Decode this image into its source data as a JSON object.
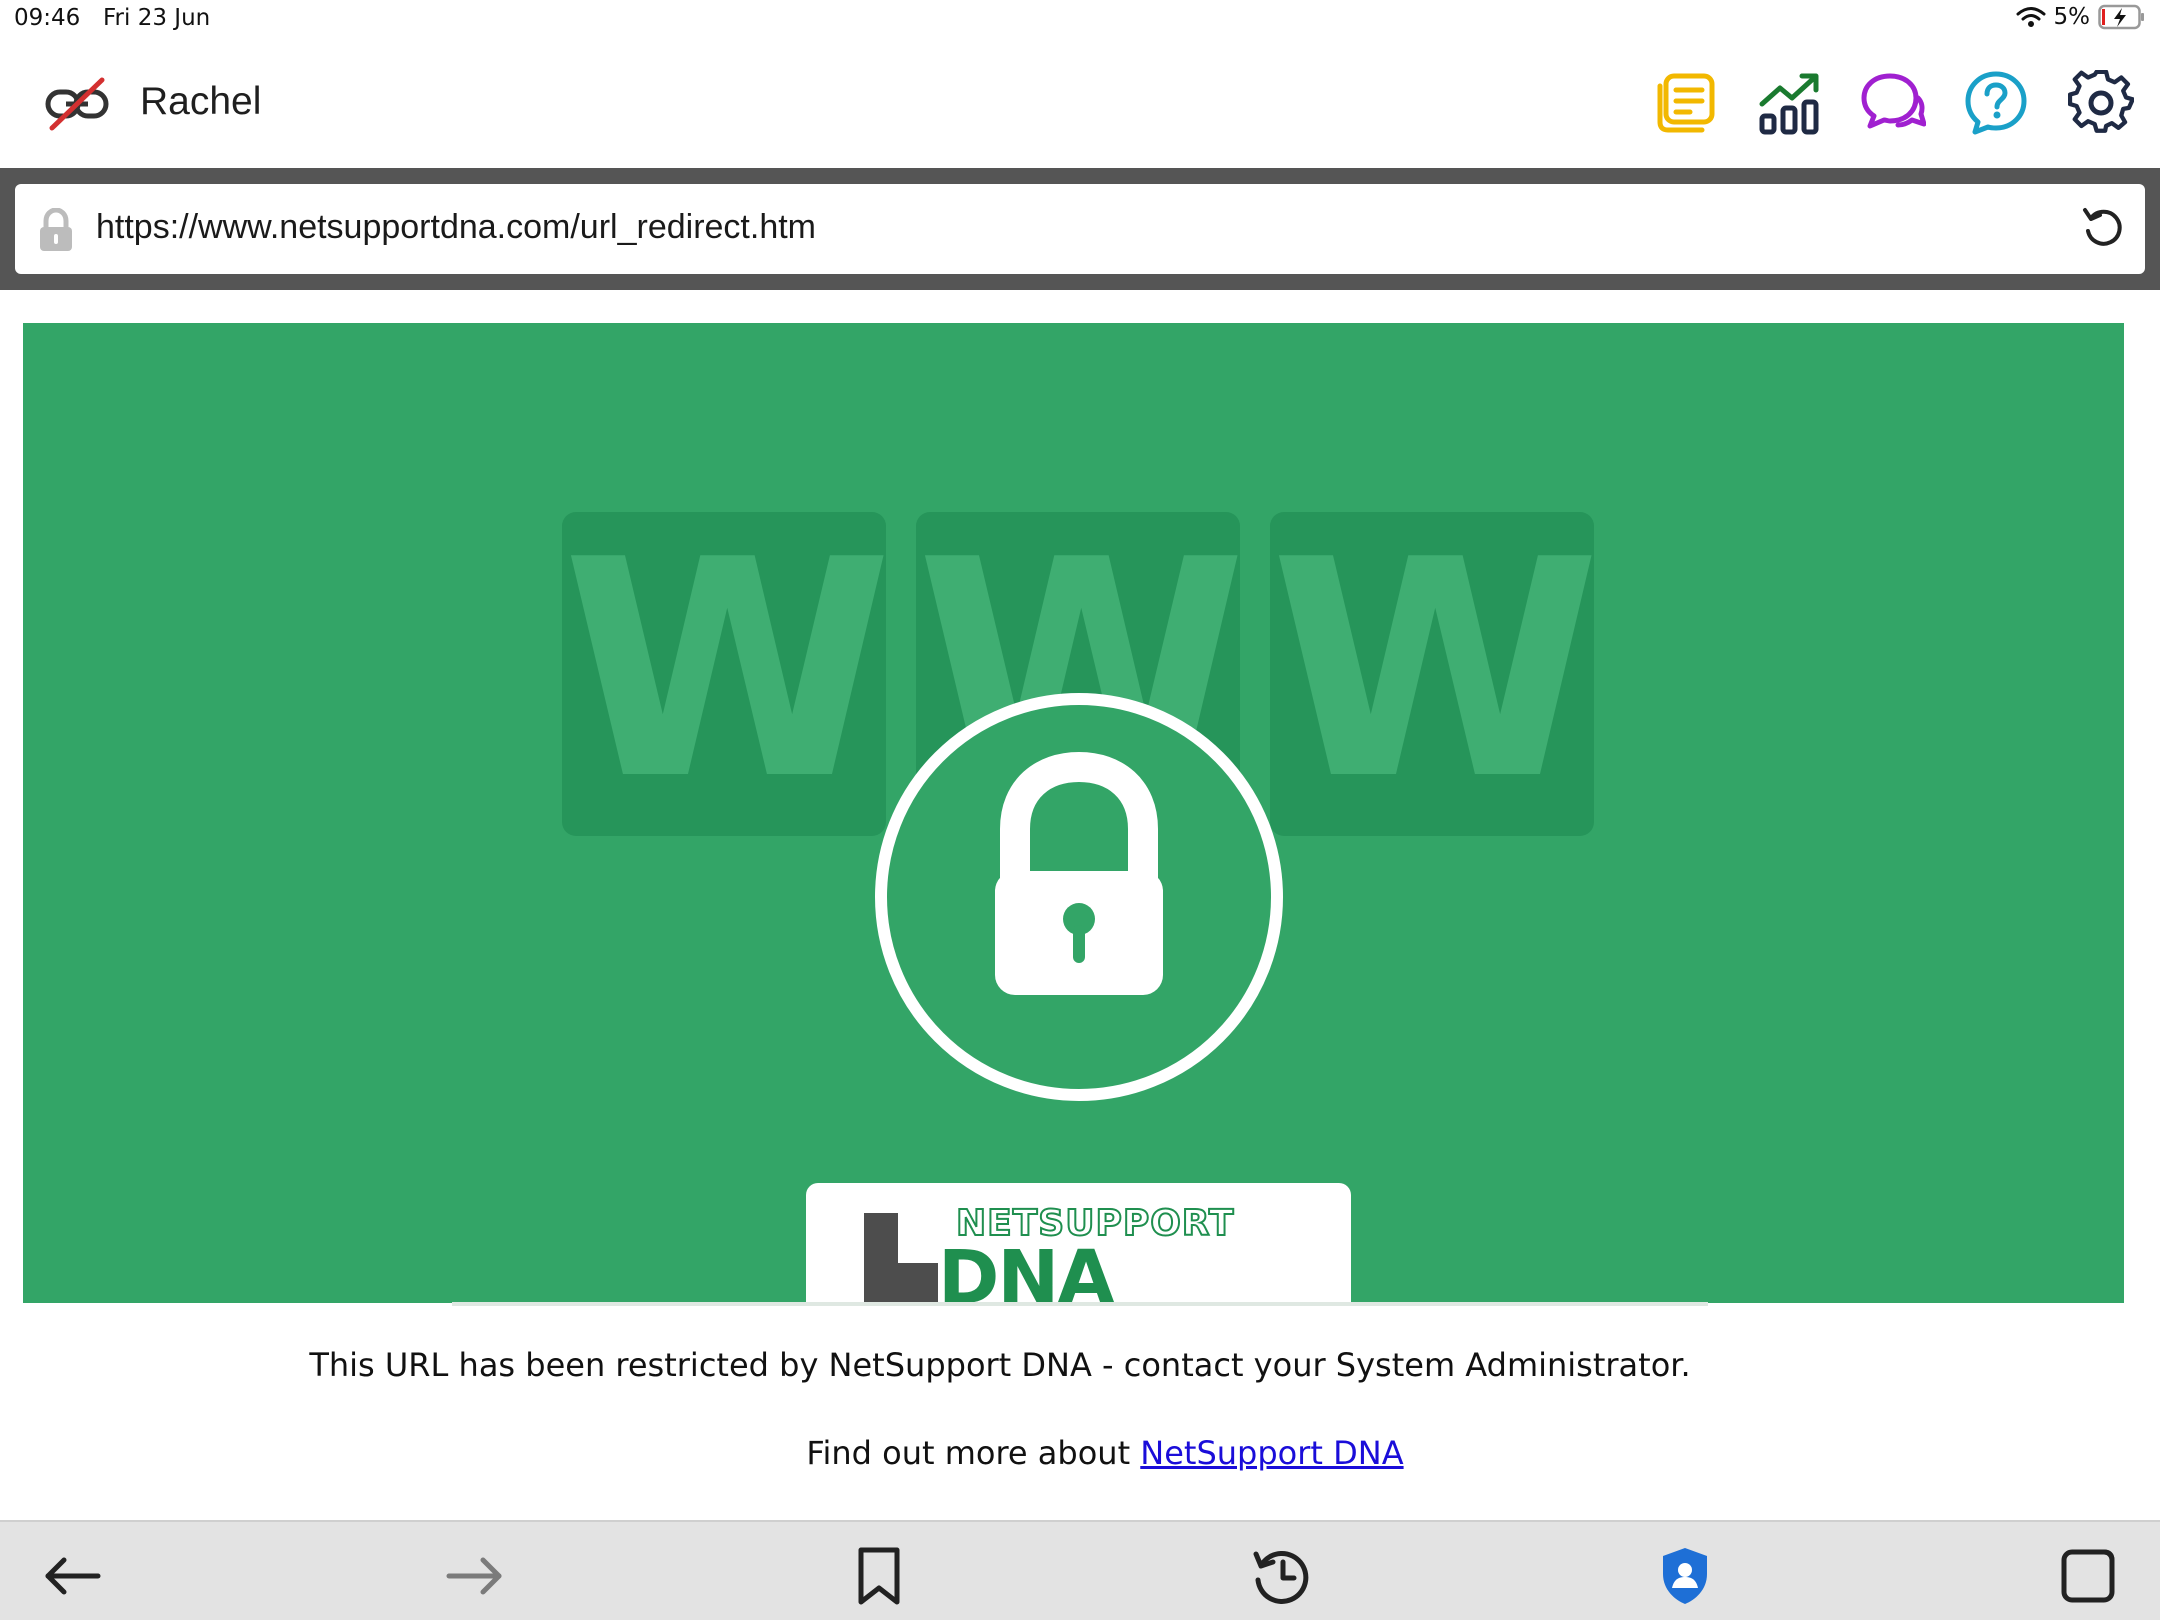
{
  "status_bar": {
    "time": "09:46",
    "date": "Fri 23 Jun",
    "battery": "5%",
    "icons": [
      "wifi-icon",
      "battery-charging-icon"
    ]
  },
  "header": {
    "user_name": "Rachel",
    "connection_icon": "link-disconnected-icon",
    "tools": [
      {
        "name": "notes-icon",
        "color": "#f2b800"
      },
      {
        "name": "stats-icon",
        "color": "#1a7a2f"
      },
      {
        "name": "chat-icon",
        "color": "#a020d0"
      },
      {
        "name": "help-icon",
        "color": "#1aa0c8"
      },
      {
        "name": "settings-icon",
        "color": "#1f2a44"
      }
    ]
  },
  "address_bar": {
    "url": "https://www.netsupportdna.com/url_redirect.htm"
  },
  "page": {
    "banner_letters": [
      "W",
      "W",
      "W"
    ],
    "logo_line1": "NETSUPPORT",
    "logo_line2": "DNA",
    "logo_small": "D",
    "restriction_message": "This URL has been restricted by NetSupport DNA - contact your System Administrator.",
    "more_prefix": "Find out more about ",
    "more_link": "NetSupport DNA",
    "colors": {
      "banner_green": "#33a567",
      "box_green": "#26955a",
      "link_blue": "#1a0dd9"
    }
  },
  "bottom_toolbar": {
    "buttons": [
      "back-icon",
      "forward-icon",
      "bookmark-icon",
      "history-icon",
      "shield-user-icon",
      "tabs-icon"
    ]
  }
}
